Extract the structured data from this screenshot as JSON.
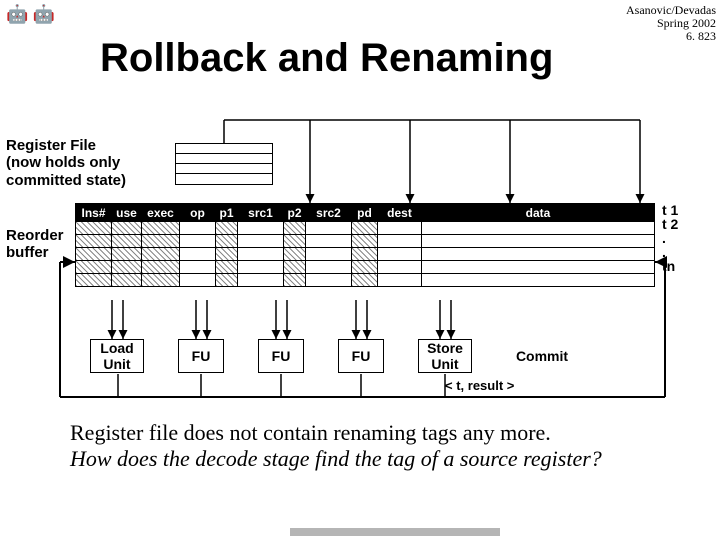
{
  "header": {
    "authors": "Asanovic/Devadas",
    "term": "Spring 2002",
    "course": "6. 823"
  },
  "title": "Rollback and Renaming",
  "labels": {
    "regfile": "Register File\n(now holds only\ncommitted state)",
    "rob": "Reorder\nbuffer"
  },
  "rob": {
    "columns": [
      "Ins#",
      "use",
      "exec",
      "op",
      "p1",
      "src1",
      "p2",
      "src2",
      "pd",
      "dest",
      "data"
    ],
    "rows": 5,
    "t_labels": [
      "t 1",
      "t 2",
      ".",
      ".",
      "tn"
    ]
  },
  "units": {
    "load": "Load\nUnit",
    "fu": "FU",
    "store": "Store\nUnit",
    "commit": "Commit"
  },
  "result_tag": "< t, result >",
  "body": {
    "line1": "Register file does not contain renaming tags any more.",
    "line2": "How does the decode stage find the tag of a source register?"
  }
}
